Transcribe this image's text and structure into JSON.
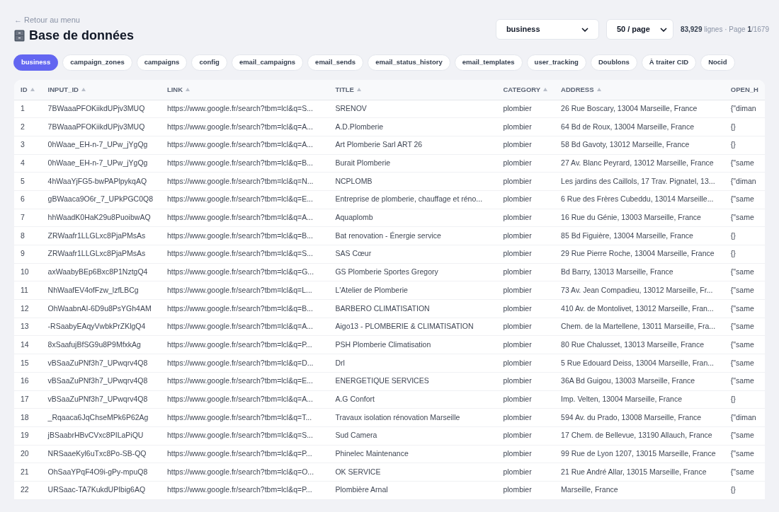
{
  "back_link": "← Retour au menu",
  "title": "Base de données",
  "table_select": {
    "value": "business"
  },
  "page_size_select": {
    "value": "50 / page"
  },
  "summary": "**83,929** lignes · Page **1**/1679",
  "tabs": [
    {
      "label": "business",
      "selected": true
    },
    {
      "label": "campaign_zones",
      "selected": false
    },
    {
      "label": "campaigns",
      "selected": false
    },
    {
      "label": "config",
      "selected": false
    },
    {
      "label": "email_campaigns",
      "selected": false
    },
    {
      "label": "email_sends",
      "selected": false
    },
    {
      "label": "email_status_history",
      "selected": false
    },
    {
      "label": "email_templates",
      "selected": false
    },
    {
      "label": "user_tracking",
      "selected": false
    },
    {
      "label": "Doublons",
      "selected": false
    },
    {
      "label": "À traiter CID",
      "selected": false
    },
    {
      "label": "Nocid",
      "selected": false
    }
  ],
  "table": {
    "columns": [
      "ID",
      "INPUT_ID",
      "LINK",
      "TITLE",
      "CATEGORY",
      "ADDRESS",
      "OPEN_H"
    ],
    "rows": [
      [
        "1",
        "7BWaaaPFOKiikdUPjv3MUQ",
        "https://www.google.fr/search?tbm=lcl&q=S...",
        "SRENOV",
        "plombier",
        "26 Rue Boscary, 13004 Marseille, France",
        "{\"diman"
      ],
      [
        "2",
        "7BWaaaPFOKiikdUPjv3MUQ",
        "https://www.google.fr/search?tbm=lcl&q=A...",
        "A.D.Plomberie",
        "plombier",
        "64 Bd de Roux, 13004 Marseille, France",
        "{}"
      ],
      [
        "3",
        "0hWaae_EH-n-7_UPw_jYgQg",
        "https://www.google.fr/search?tbm=lcl&q=A...",
        "Art Plomberie Sarl ART 26",
        "plombier",
        "58 Bd Gavoty, 13012 Marseille, France",
        "{}"
      ],
      [
        "4",
        "0hWaae_EH-n-7_UPw_jYgQg",
        "https://www.google.fr/search?tbm=lcl&q=B...",
        "Burait Plomberie",
        "plombier",
        "27 Av. Blanc Peyrard, 13012 Marseille, France",
        "{\"same"
      ],
      [
        "5",
        "4hWaaYjFG5-bwPAPlpykqAQ",
        "https://www.google.fr/search?tbm=lcl&q=N...",
        "NCPLOMB",
        "plombier",
        "Les jardins des Caillols, 17 Trav. Pignatel, 13...",
        "{\"diman"
      ],
      [
        "6",
        "gBWaaca9O6r_7_UPkPGC0Q8",
        "https://www.google.fr/search?tbm=lcl&q=E...",
        "Entreprise de plomberie, chauffage et réno...",
        "plombier",
        "6 Rue des Frères Cubeddu, 13014 Marseille...",
        "{\"same"
      ],
      [
        "7",
        "hhWaadK0HaK29u8PuoibwAQ",
        "https://www.google.fr/search?tbm=lcl&q=A...",
        "Aquaplomb",
        "plombier",
        "16 Rue du Génie, 13003 Marseille, France",
        "{\"same"
      ],
      [
        "8",
        "ZRWaafr1LLGLxc8PjaPMsAs",
        "https://www.google.fr/search?tbm=lcl&q=B...",
        "Bat renovation - Énergie service",
        "plombier",
        "85 Bd Figuière, 13004 Marseille, France",
        "{}"
      ],
      [
        "9",
        "ZRWaafr1LLGLxc8PjaPMsAs",
        "https://www.google.fr/search?tbm=lcl&q=S...",
        "SAS Cœur",
        "plombier",
        "29 Rue Pierre Roche, 13004 Marseille, France",
        "{}"
      ],
      [
        "10",
        "axWaabyBEp6Bxc8P1NztgQ4",
        "https://www.google.fr/search?tbm=lcl&q=G...",
        "GS Plomberie Sportes Gregory",
        "plombier",
        "Bd Barry, 13013 Marseille, France",
        "{\"same"
      ],
      [
        "11",
        "NhWaafEV4ofFzw_lzfLBCg",
        "https://www.google.fr/search?tbm=lcl&q=L...",
        "L'Atelier de Plomberie",
        "plombier",
        "73 Av. Jean Compadieu, 13012 Marseille, Fr...",
        "{\"same"
      ],
      [
        "12",
        "OhWaabnAI-6D9u8PsYGh4AM",
        "https://www.google.fr/search?tbm=lcl&q=B...",
        "BARBERO CLIMATISATION",
        "plombier",
        "410 Av. de Montolivet, 13012 Marseille, Fran...",
        "{\"same"
      ],
      [
        "13",
        "-RSaabyEAqyVwbkPrZKlgQ4",
        "https://www.google.fr/search?tbm=lcl&q=A...",
        "Aigo13 - PLOMBERIE & CLIMATISATION",
        "plombier",
        "Chem. de la Martellene, 13011 Marseille, Fra...",
        "{\"same"
      ],
      [
        "14",
        "8xSaafujBfSG9u8P9MfxkAg",
        "https://www.google.fr/search?tbm=lcl&q=P...",
        "PSH Plomberie Climatisation",
        "plombier",
        "80 Rue Chalusset, 13013 Marseille, France",
        "{\"same"
      ],
      [
        "15",
        "vBSaaZuPNf3h7_UPwqrv4Q8",
        "https://www.google.fr/search?tbm=lcl&q=D...",
        "Drl",
        "plombier",
        "5 Rue Edouard Deiss, 13004 Marseille, Fran...",
        "{\"same"
      ],
      [
        "16",
        "vBSaaZuPNf3h7_UPwqrv4Q8",
        "https://www.google.fr/search?tbm=lcl&q=E...",
        "ENERGETIQUE SERVICES",
        "plombier",
        "36A Bd Guigou, 13003 Marseille, France",
        "{\"same"
      ],
      [
        "17",
        "vBSaaZuPNf3h7_UPwqrv4Q8",
        "https://www.google.fr/search?tbm=lcl&q=A...",
        "A.G Confort",
        "plombier",
        "Imp. Velten, 13004 Marseille, France",
        "{}"
      ],
      [
        "18",
        "_Rqaaca6JqChseMPk6P62Ag",
        "https://www.google.fr/search?tbm=lcl&q=T...",
        "Travaux isolation rénovation Marseille",
        "plombier",
        "594 Av. du Prado, 13008 Marseille, France",
        "{\"diman"
      ],
      [
        "19",
        "jBSaabrHBvCVxc8PILaPiQU",
        "https://www.google.fr/search?tbm=lcl&q=S...",
        "Sud Camera",
        "plombier",
        "17 Chem. de Bellevue, 13190 Allauch, France",
        "{\"same"
      ],
      [
        "20",
        "NRSaaeKyl6uTxc8Po-SB-QQ",
        "https://www.google.fr/search?tbm=lcl&q=P...",
        "Phinelec Maintenance",
        "plombier",
        "99 Rue de Lyon 1207, 13015 Marseille, France",
        "{\"same"
      ],
      [
        "21",
        "OhSaaYPqF4O9i-gPy-mpuQ8",
        "https://www.google.fr/search?tbm=lcl&q=O...",
        "OK SERVICE",
        "plombier",
        "21 Rue André Allar, 13015 Marseille, France",
        "{\"same"
      ],
      [
        "22",
        "URSaac-TA7KukdUPIbig6AQ",
        "https://www.google.fr/search?tbm=lcl&q=P...",
        "Plombière Arnal",
        "plombier",
        "Marseille, France",
        "{}"
      ]
    ]
  }
}
